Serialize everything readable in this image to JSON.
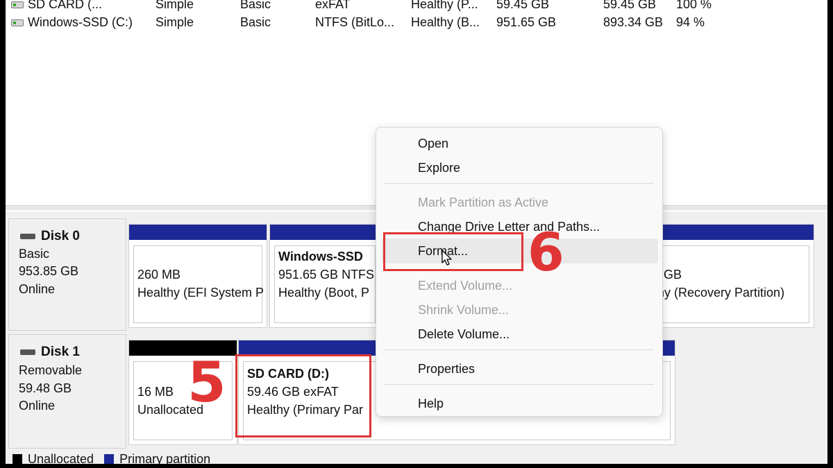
{
  "volume_list": {
    "rows": [
      {
        "volume": "SD CARD (...",
        "layout": "Simple",
        "type": "Basic",
        "fs": "exFAT",
        "status": "Healthy (P...",
        "capacity": "59.45 GB",
        "free": "59.45 GB",
        "pct": "100 %"
      },
      {
        "volume": "Windows-SSD (C:)",
        "layout": "Simple",
        "type": "Basic",
        "fs": "NTFS (BitLo...",
        "status": "Healthy (B...",
        "capacity": "951.65 GB",
        "free": "893.34 GB",
        "pct": "94 %"
      }
    ]
  },
  "disks": [
    {
      "title": "Disk 0",
      "kind": "Basic",
      "size": "953.85 GB",
      "state": "Online",
      "partitions": [
        {
          "name": "",
          "size": "260 MB",
          "status": "Healthy (EFI System P"
        },
        {
          "name": "Windows-SSD",
          "size": "951.65 GB NTFS",
          "status": "Healthy (Boot, P"
        },
        {
          "name": "",
          "size": "GB",
          "status": "thy (Recovery Partition)"
        }
      ]
    },
    {
      "title": "Disk 1",
      "kind": "Removable",
      "size": "59.48 GB",
      "state": "Online",
      "partitions": [
        {
          "name": "",
          "size": "16 MB",
          "status": "Unallocated"
        },
        {
          "name": "SD CARD  (D:)",
          "size": "59.46 GB exFAT",
          "status": "Healthy (Primary Par"
        }
      ]
    }
  ],
  "legend": {
    "unallocated": "Unallocated",
    "primary": "Primary partition"
  },
  "context_menu": {
    "items": [
      {
        "label": "Open",
        "enabled": true
      },
      {
        "label": "Explore",
        "enabled": true
      },
      {
        "label": "Mark Partition as Active",
        "enabled": false
      },
      {
        "label": "Change Drive Letter and Paths...",
        "enabled": true
      },
      {
        "label": "Format...",
        "enabled": true
      },
      {
        "label": "Extend Volume...",
        "enabled": false
      },
      {
        "label": "Shrink Volume...",
        "enabled": false
      },
      {
        "label": "Delete Volume...",
        "enabled": true
      },
      {
        "label": "Properties",
        "enabled": true
      },
      {
        "label": "Help",
        "enabled": true
      }
    ]
  },
  "annotations": {
    "step_select": "5",
    "step_format": "6"
  },
  "colors": {
    "primary_bar": "#1c2896",
    "unallocated_bar": "#000000",
    "callout": "#e03535"
  }
}
